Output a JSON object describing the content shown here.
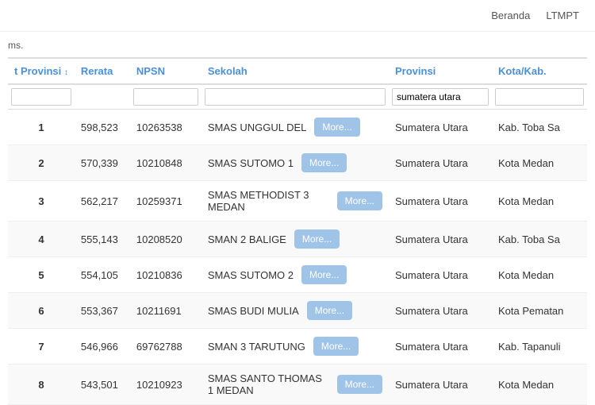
{
  "nav": {
    "beranda": "Beranda",
    "ltmpt": "LTMPT"
  },
  "subtitle": "ms.",
  "table": {
    "headers": {
      "rank": "t Provinsi",
      "rerata": "Rerata",
      "npsn": "NPSN",
      "sekolah": "Sekolah",
      "provinsi": "Provinsi",
      "kotakab": "Kota/Kab."
    },
    "filters": {
      "rank": "",
      "rerata": "",
      "npsn": "",
      "sekolah": "",
      "provinsi": "sumatera utara",
      "kotakab": ""
    },
    "more_label": "More...",
    "rows": [
      {
        "rank": "1",
        "rerata": "598,523",
        "npsn": "10263538",
        "sekolah": "SMAS UNGGUL DEL",
        "provinsi": "Sumatera Utara",
        "kotakab": "Kab. Toba Sa"
      },
      {
        "rank": "2",
        "rerata": "570,339",
        "npsn": "10210848",
        "sekolah": "SMAS SUTOMO 1",
        "provinsi": "Sumatera Utara",
        "kotakab": "Kota Medan"
      },
      {
        "rank": "3",
        "rerata": "562,217",
        "npsn": "10259371",
        "sekolah": "SMAS METHODIST 3 MEDAN",
        "provinsi": "Sumatera Utara",
        "kotakab": "Kota Medan"
      },
      {
        "rank": "4",
        "rerata": "555,143",
        "npsn": "10208520",
        "sekolah": "SMAN 2 BALIGE",
        "provinsi": "Sumatera Utara",
        "kotakab": "Kab. Toba Sa"
      },
      {
        "rank": "5",
        "rerata": "554,105",
        "npsn": "10210836",
        "sekolah": "SMAS SUTOMO 2",
        "provinsi": "Sumatera Utara",
        "kotakab": "Kota Medan"
      },
      {
        "rank": "6",
        "rerata": "553,367",
        "npsn": "10211691",
        "sekolah": "SMAS BUDI MULIA",
        "provinsi": "Sumatera Utara",
        "kotakab": "Kota Pematan"
      },
      {
        "rank": "7",
        "rerata": "546,966",
        "npsn": "69762788",
        "sekolah": "SMAN 3 TARUTUNG",
        "provinsi": "Sumatera Utara",
        "kotakab": "Kab. Tapanuli"
      },
      {
        "rank": "8",
        "rerata": "543,501",
        "npsn": "10210923",
        "sekolah": "SMAS SANTO THOMAS 1 MEDAN",
        "provinsi": "Sumatera Utara",
        "kotakab": "Kota Medan"
      }
    ]
  }
}
